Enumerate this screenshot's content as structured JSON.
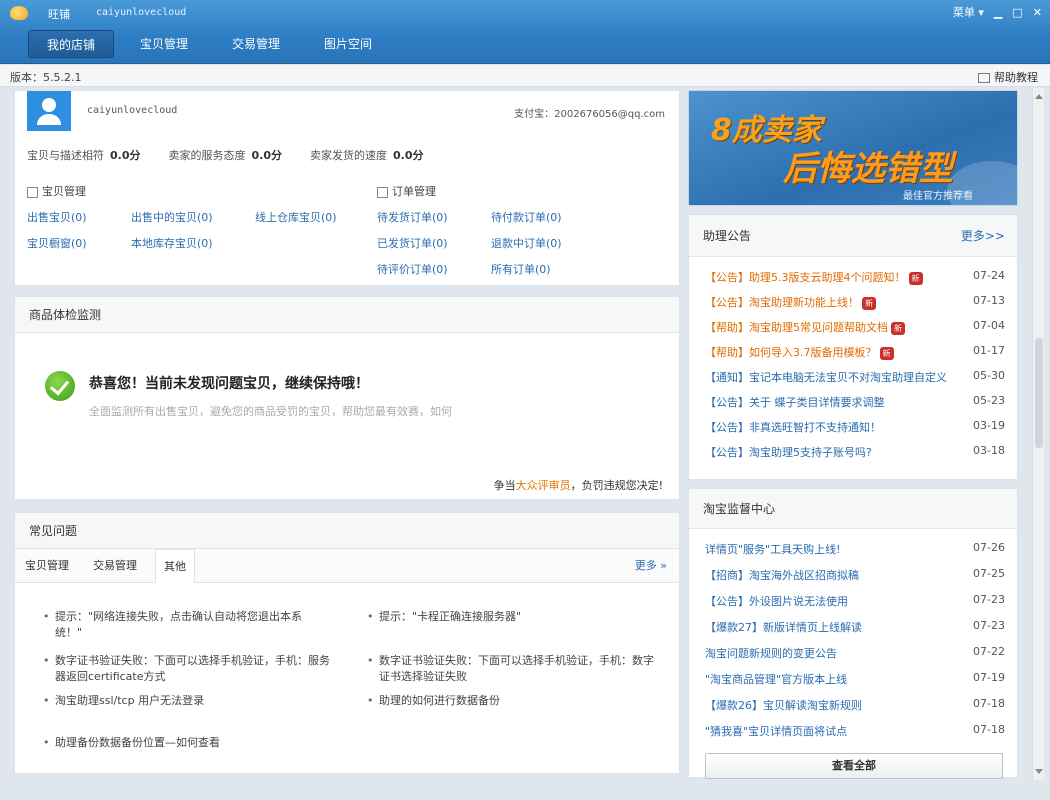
{
  "titlebar": {
    "app_name": "旺铺",
    "user": "caiyunlovecloud",
    "menu_label": "菜单 ▾",
    "tabs": [
      "我的店铺",
      "宝贝管理",
      "交易管理",
      "图片空间"
    ]
  },
  "version": {
    "label": "版本：5.5.2.1",
    "help": "帮助教程"
  },
  "account": {
    "username": "caiyunlovecloud",
    "alipay": "支付宝：2002676056@qq.com",
    "ratings": [
      {
        "label": "宝贝与描述相符",
        "value": "0.0分"
      },
      {
        "label": "卖家的服务态度",
        "value": "0.0分"
      },
      {
        "label": "卖家发货的速度",
        "value": "0.0分"
      }
    ],
    "goods_title": "宝贝管理",
    "goods_links": [
      "出售宝贝(0)",
      "出售中的宝贝(0)",
      "线上仓库宝贝(0)",
      "宝贝橱窗(0)",
      "本地库存宝贝(0)"
    ],
    "orders_title": "订单管理",
    "order_links": [
      "待发货订单(0)",
      "待付款订单(0)",
      "已发货订单(0)",
      "退款中订单(0)",
      "待评价订单(0)",
      "所有订单(0)"
    ]
  },
  "check": {
    "title": "商品体检监测",
    "ok_title": "恭喜您！当前未发现问题宝贝，继续保持哦！",
    "ok_sub": "全面监测所有出售宝贝，避免您的商品受罚的宝贝，帮助您最有效赛，如何",
    "footer_prefix": "争当",
    "footer_highlight": "大众评审员",
    "footer_suffix": "，负罚违规您决定!"
  },
  "faq": {
    "title": "常见问题",
    "tabs": [
      "宝贝管理",
      "交易管理",
      "其他"
    ],
    "more": "更多 »",
    "items": [
      "提示：\"网络连接失败，点击确认自动将您退出本系统！\"",
      "提示：\"卡程正确连接服务器\"",
      "数字证书验证失败：下面可以选择手机验证，手机：服务器返回certificate方式",
      "数字证书验证失败：下面可以选择手机验证，手机：数字证书选择验证失败",
      "淘宝助理ssl/tcp 用户无法登录",
      "助理的如何进行数据备份",
      "助理备份数据备份位置—如何查看"
    ]
  },
  "banner": {
    "line1": "8成卖家",
    "line2": "后悔选错型",
    "line3": "最佳官方推荐看"
  },
  "news": {
    "title": "助理公告",
    "more": "更多>>",
    "items": [
      {
        "text": "【公告】助理5.3版支云助理4个问题知！",
        "date": "07-24",
        "color": "orange",
        "badge": "新"
      },
      {
        "text": "【公告】淘宝助理新功能上线！",
        "date": "07-13",
        "color": "orange",
        "badge": "新"
      },
      {
        "text": "【帮助】淘宝助理5常见问题帮助文档",
        "date": "07-04",
        "color": "orange",
        "badge": "新"
      },
      {
        "text": "【帮助】如何导入3.7版备用模板？",
        "date": "01-17",
        "color": "orange",
        "badge": "新"
      },
      {
        "text": "【通知】宝记本电脑无法宝贝不对淘宝助理自定义",
        "date": "05-30",
        "color": "blue",
        "badge": ""
      },
      {
        "text": "【公告】关于 蝶子类目详情要求调整",
        "date": "05-23",
        "color": "blue",
        "badge": ""
      },
      {
        "text": "【公告】非真选旺智打不支持通知！",
        "date": "03-19",
        "color": "blue",
        "badge": ""
      },
      {
        "text": "【公告】淘宝助理5支持子账号吗?",
        "date": "03-18",
        "color": "blue",
        "badge": ""
      }
    ]
  },
  "center": {
    "title": "淘宝监督中心",
    "view_all": "查看全部",
    "items": [
      {
        "text": "详情页\"服务\"工具天购上线!",
        "date": "07-26"
      },
      {
        "text": "【招商】淘宝海外战区招商拟稿",
        "date": "07-25"
      },
      {
        "text": "【公告】外设图片说无法使用",
        "date": "07-23"
      },
      {
        "text": "【爆款27】新版详情页上线解读",
        "date": "07-23"
      },
      {
        "text": "淘宝问题新规则的变更公告",
        "date": "07-22"
      },
      {
        "text": "\"淘宝商品管理\"官方版本上线",
        "date": "07-19"
      },
      {
        "text": "【爆款26】宝贝解读淘宝新规则",
        "date": "07-18"
      },
      {
        "text": "\"猜我喜\"宝贝详情页面将试点",
        "date": "07-18"
      }
    ]
  }
}
